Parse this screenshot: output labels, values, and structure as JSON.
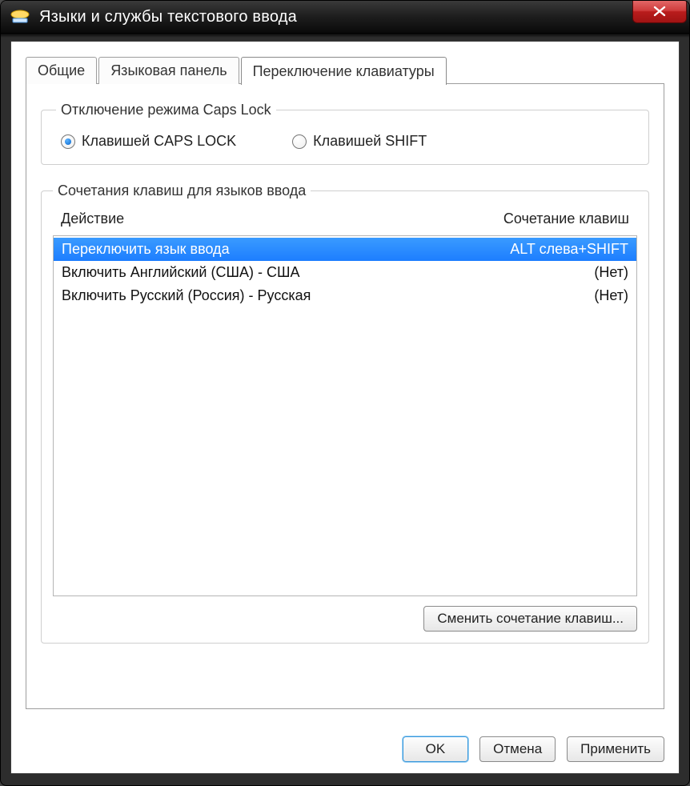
{
  "window": {
    "title": "Языки и службы текстового ввода"
  },
  "tabs": {
    "general": "Общие",
    "panel": "Языковая панель",
    "switch": "Переключение клавиатуры"
  },
  "capsGroup": {
    "legend": "Отключение режима Caps Lock",
    "radioCaps": "Клавишей CAPS LOCK",
    "radioShift": "Клавишей SHIFT"
  },
  "hotkeyGroup": {
    "legend": "Сочетания клавиш для языков ввода",
    "colAction": "Действие",
    "colKeys": "Сочетание клавиш",
    "rows": [
      {
        "action": "Переключить язык ввода",
        "keys": "ALT слева+SHIFT"
      },
      {
        "action": "Включить Английский (США) - США",
        "keys": "(Нет)"
      },
      {
        "action": "Включить Русский (Россия) - Русская",
        "keys": "(Нет)"
      }
    ],
    "changeBtn": "Сменить сочетание клавиш..."
  },
  "buttons": {
    "ok": "OK",
    "cancel": "Отмена",
    "apply": "Применить"
  }
}
